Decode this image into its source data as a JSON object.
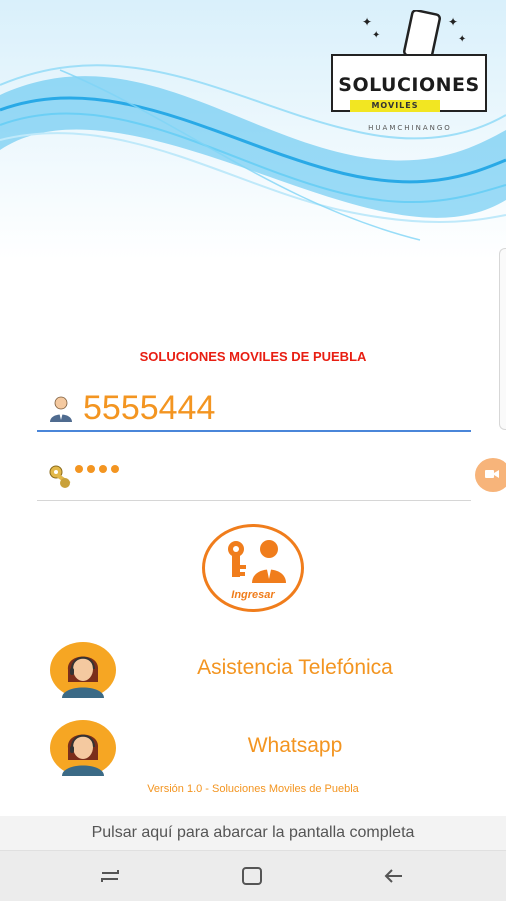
{
  "logo": {
    "title": "SOLUCIONES",
    "subtitle": "MOVILES",
    "tagline": "HUAMCHINANGO"
  },
  "company_name": "SOLUCIONES MOVILES DE PUEBLA",
  "login": {
    "username_value": "5555444",
    "password_dots": 4,
    "button_label": "Ingresar"
  },
  "contacts": [
    {
      "label": "Asistencia Telefónica",
      "icon": "agent-avatar-icon"
    },
    {
      "label": "Whatsapp",
      "icon": "agent-avatar-icon"
    }
  ],
  "version_text": "Versión 1.0  - Soluciones Moviles de Puebla",
  "fullscreen_hint": "Pulsar aquí para abarcar la pantalla completa",
  "colors": {
    "accent": "#f39521",
    "title_red": "#e81e12",
    "focus_line": "#4a86d9"
  }
}
